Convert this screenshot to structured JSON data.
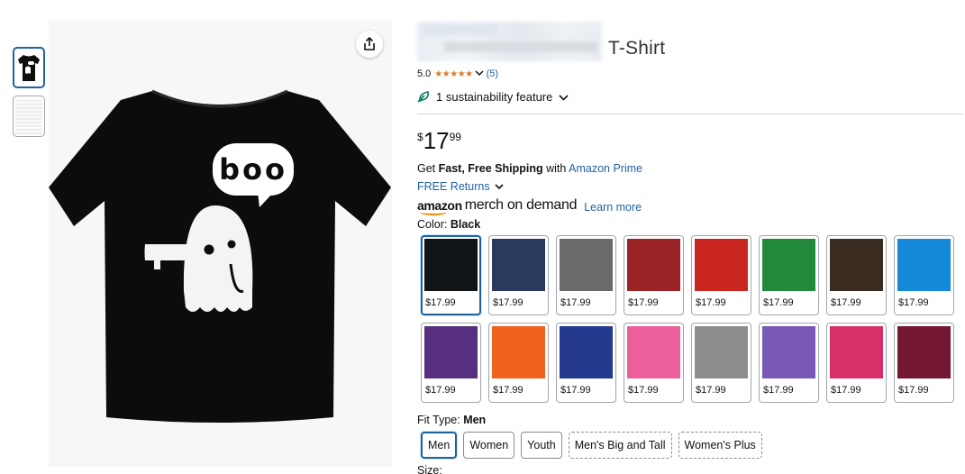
{
  "product": {
    "title_suffix": "T-Shirt",
    "rating_value": "5.0",
    "rating_stars": "★★★★★",
    "rating_count": "(5)",
    "sustainability": "1 sustainability feature",
    "price": {
      "symbol": "$",
      "whole": "17",
      "fraction": "99"
    }
  },
  "graphic": {
    "speech_text": "boo"
  },
  "shipping": {
    "get": "Get ",
    "fast_free": "Fast, Free Shipping",
    "with": " with ",
    "prime": "Amazon Prime",
    "returns": "FREE Returns"
  },
  "merch": {
    "brand": "amazon",
    "tagline": "merch on demand",
    "learn_more": "Learn more"
  },
  "color": {
    "label": "Color: ",
    "selected": "Black",
    "options": [
      {
        "hex": "#111417",
        "price": "$17.99"
      },
      {
        "hex": "#2a3a5c",
        "price": "$17.99"
      },
      {
        "hex": "#6a6a68",
        "price": "$17.99"
      },
      {
        "hex": "#9a2326",
        "price": "$17.99"
      },
      {
        "hex": "#c9261f",
        "price": "$17.99"
      },
      {
        "hex": "#238a3c",
        "price": "$17.99"
      },
      {
        "hex": "#3b2c22",
        "price": "$17.99"
      },
      {
        "hex": "#1688d8",
        "price": "$17.99"
      },
      {
        "hex": "#56307e",
        "price": "$17.99"
      },
      {
        "hex": "#f2621f",
        "price": "$17.99"
      },
      {
        "hex": "#25398f",
        "price": "$17.99"
      },
      {
        "hex": "#ec5f9a",
        "price": "$17.99"
      },
      {
        "hex": "#8b8e8a",
        "price": "$17.99"
      },
      {
        "hex": "#7958b6",
        "price": "$17.99"
      },
      {
        "hex": "#d72f67",
        "price": "$17.99"
      },
      {
        "hex": "#741733",
        "price": "$17.99"
      }
    ]
  },
  "fit": {
    "label": "Fit Type: ",
    "selected": "Men",
    "options": [
      {
        "label": "Men"
      },
      {
        "label": "Women"
      },
      {
        "label": "Youth"
      },
      {
        "label": "Men's Big and Tall"
      },
      {
        "label": "Women's Plus"
      }
    ]
  },
  "size": {
    "label": "Size:"
  },
  "colors": {
    "link": "#2162a1",
    "star": "#de7921",
    "leaf": "#067d62"
  }
}
